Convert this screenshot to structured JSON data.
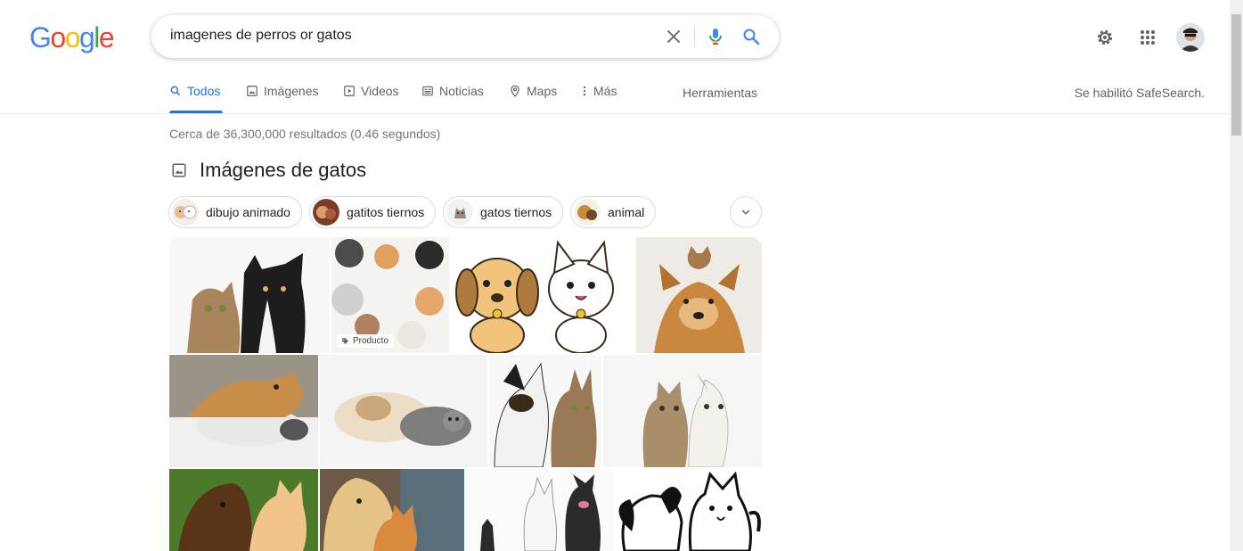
{
  "logo": {
    "text": "Google"
  },
  "search": {
    "query": "imagenes de perros or gatos"
  },
  "tabs": [
    {
      "label": "Todos",
      "icon": "search-icon"
    },
    {
      "label": "Imágenes",
      "icon": "image-icon"
    },
    {
      "label": "Videos",
      "icon": "play-icon"
    },
    {
      "label": "Noticias",
      "icon": "news-icon"
    },
    {
      "label": "Maps",
      "icon": "map-pin-icon"
    },
    {
      "label": "Más",
      "icon": "more-vert-icon"
    }
  ],
  "tools_label": "Herramientas",
  "safesearch_label": "Se habilitó SafeSearch.",
  "stats": "Cerca de 36,300,000 resultados (0.46 segundos)",
  "images_section": {
    "title": "Imágenes de gatos",
    "chips": [
      {
        "label": "dibujo animado"
      },
      {
        "label": "gatitos tiernos"
      },
      {
        "label": "gatos tiernos"
      },
      {
        "label": "animal"
      }
    ],
    "product_badge": "Producto"
  },
  "colors": {
    "google_blue": "#4285f4",
    "google_red": "#ea4335",
    "google_yellow": "#fbbc05",
    "google_green": "#34a853",
    "accent": "#1a73e8"
  }
}
